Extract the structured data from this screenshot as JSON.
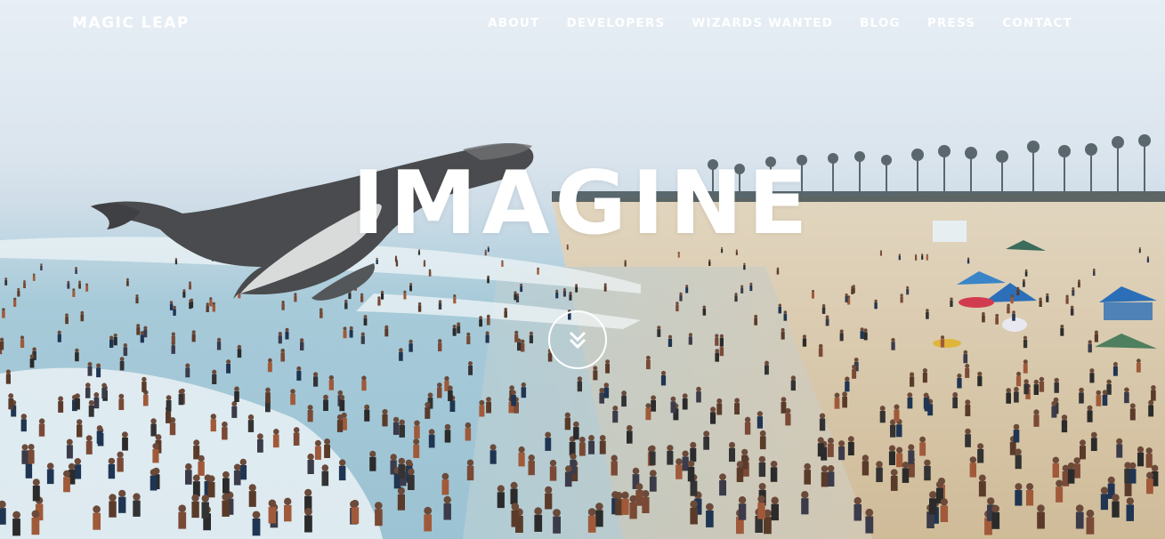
{
  "brand": {
    "name": "MAGIC LEAP"
  },
  "nav": {
    "items": [
      {
        "label": "ABOUT"
      },
      {
        "label": "DEVELOPERS"
      },
      {
        "label": "WIZARDS WANTED"
      },
      {
        "label": "BLOG"
      },
      {
        "label": "PRESS"
      },
      {
        "label": "CONTACT"
      }
    ]
  },
  "hero": {
    "headline": "IMAGINE",
    "scroll_icon": "double-chevron-down-icon",
    "background": "beach-with-humpback-whale-photo"
  },
  "colors": {
    "text": "#ffffff",
    "sky": "#e2eaf2",
    "sea": "#9cc3d3",
    "sand": "#d8c7a8"
  }
}
